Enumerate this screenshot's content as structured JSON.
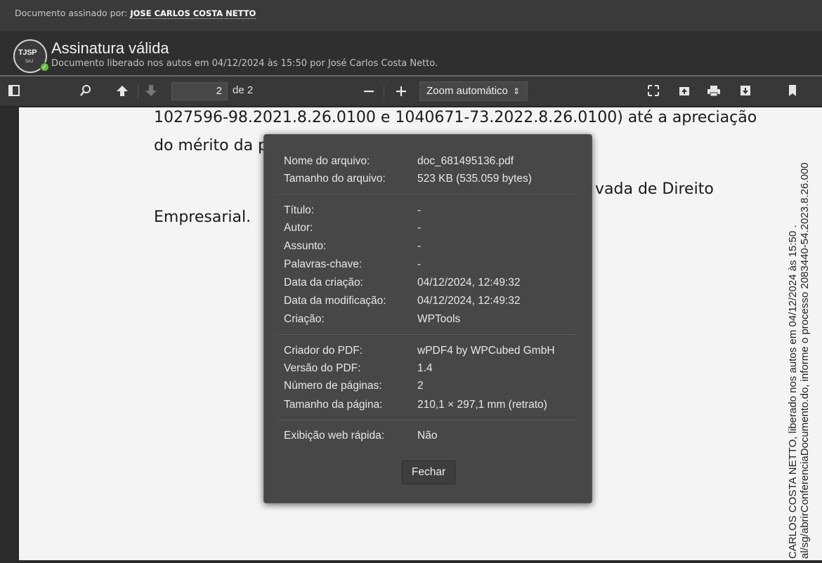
{
  "signed_bar": {
    "prefix": "Documento assinado por: ",
    "signer": "JOSE CARLOS COSTA NETTO"
  },
  "signature": {
    "seal_text": "TJSP",
    "seal_sub": "SAJ",
    "title": "Assinatura válida",
    "subtitle": "Documento liberado nos autos em 04/12/2024 às 15:50 por José Carlos Costa Netto."
  },
  "toolbar": {
    "icons": [
      "sidebar-toggle-icon",
      "search-icon",
      "previous-page-icon",
      "next-page-icon",
      "zoom-out-icon",
      "zoom-in-icon",
      "presentation-mode-icon",
      "open-file-icon",
      "print-icon",
      "download-icon",
      "bookmark-icon"
    ],
    "page_number": "2",
    "page_of": "de 2",
    "zoom_minus": "—",
    "zoom_plus": "+",
    "zoom_value": "Zoom automático"
  },
  "document": {
    "line1": "1027596-98.2021.8.26.0100 e 1040671-73.2022.8.26.0100) até a apreciação",
    "line2": "do mérito da p",
    "line3_tail": "vada   de   Direito",
    "line4": "Empresarial.",
    "margin_text_1": "CARLOS COSTA NETTO, liberado nos autos em 04/12/2024 às 15:50 .",
    "margin_text_2": "al/sg/abrirConferenciaDocumento.do, informe o processo 2083440-54.2023.8.26.000"
  },
  "dialog": {
    "group1": [
      {
        "label": "Nome do arquivo:",
        "value": "doc_681495136.pdf"
      },
      {
        "label": "Tamanho do arquivo:",
        "value": "523 KB (535.059 bytes)"
      }
    ],
    "group2": [
      {
        "label": "Título:",
        "value": "-"
      },
      {
        "label": "Autor:",
        "value": "-"
      },
      {
        "label": "Assunto:",
        "value": "-"
      },
      {
        "label": "Palavras-chave:",
        "value": "-"
      },
      {
        "label": "Data da criação:",
        "value": "04/12/2024, 12:49:32"
      },
      {
        "label": "Data da modificação:",
        "value": "04/12/2024, 12:49:32"
      },
      {
        "label": "Criação:",
        "value": "WPTools"
      }
    ],
    "group3": [
      {
        "label": "Criador do PDF:",
        "value": "wPDF4 by WPCubed GmbH"
      },
      {
        "label": "Versão do PDF:",
        "value": "1.4"
      },
      {
        "label": "Número de páginas:",
        "value": "2"
      },
      {
        "label": "Tamanho da página:",
        "value": "210,1 × 297,1 mm (retrato)"
      }
    ],
    "group4": [
      {
        "label": "Exibição web rápida:",
        "value": "Não"
      }
    ],
    "close_label": "Fechar"
  }
}
